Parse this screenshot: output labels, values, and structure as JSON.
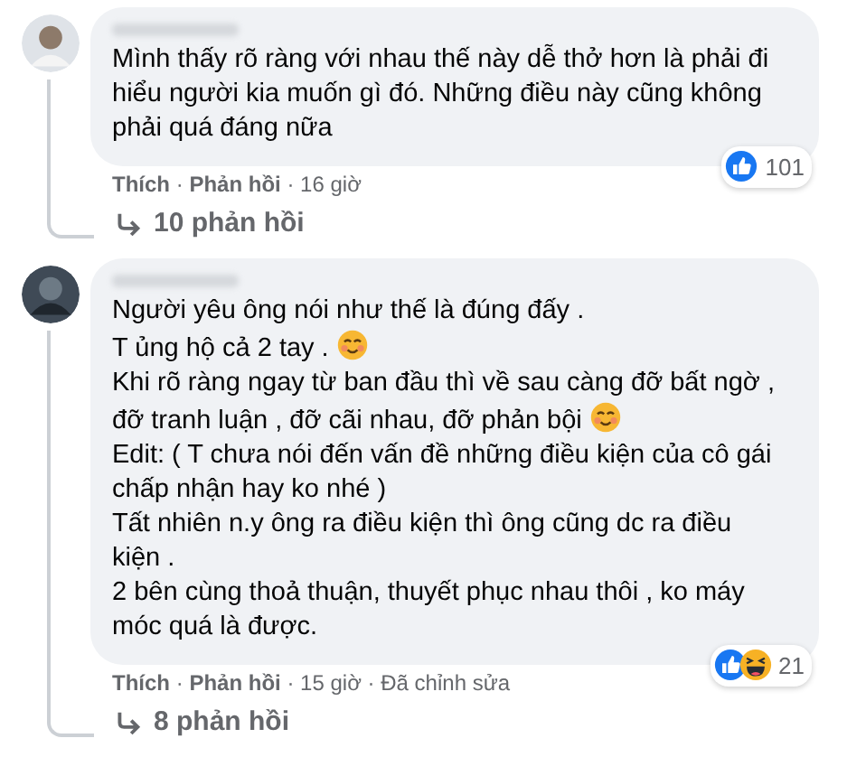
{
  "comments": [
    {
      "author_hidden": true,
      "lines": [
        {
          "text": "Mình thấy rõ ràng với nhau thế này dễ thở hơn là phải đi"
        },
        {
          "text": "hiểu người kia muốn gì đó. Những điều này cũng không"
        },
        {
          "text": "phải quá đáng nữa"
        }
      ],
      "reactions": [
        {
          "kind": "like"
        }
      ],
      "reaction_count": "101",
      "actions": [
        "Thích",
        "Phản hồi"
      ],
      "separator": "·",
      "time": "16 giờ",
      "replies": "10 phản hồi"
    },
    {
      "author_hidden": true,
      "lines": [
        {
          "text": "Người yêu ông nói như thế là đúng đấy ."
        },
        {
          "text": "T ủng hộ cả 2 tay .",
          "emoji": true
        },
        {
          "text": "Khi rõ ràng ngay từ ban đầu thì về sau càng đỡ bất ngờ ,"
        },
        {
          "text": "đỡ tranh luận , đỡ cãi nhau, đỡ phản bội",
          "emoji": true
        },
        {
          "text": "Edit: ( T chưa nói đến vấn đề những điều kiện của cô gái"
        },
        {
          "text": "chấp nhận hay ko nhé )"
        },
        {
          "text": "Tất nhiên n.y ông ra điều kiện thì ông cũng dc ra điều"
        },
        {
          "text": "kiện ."
        },
        {
          "text": "2 bên cùng thoả thuận, thuyết phục nhau thôi , ko máy"
        },
        {
          "text": "móc quá là được."
        }
      ],
      "reactions": [
        {
          "kind": "like"
        },
        {
          "kind": "haha"
        }
      ],
      "reaction_count": "21",
      "actions": [
        "Thích",
        "Phản hồi"
      ],
      "separator": "·",
      "time": "15 giờ",
      "edited": "Đã chỉnh sửa",
      "replies": "8 phản hồi"
    }
  ]
}
